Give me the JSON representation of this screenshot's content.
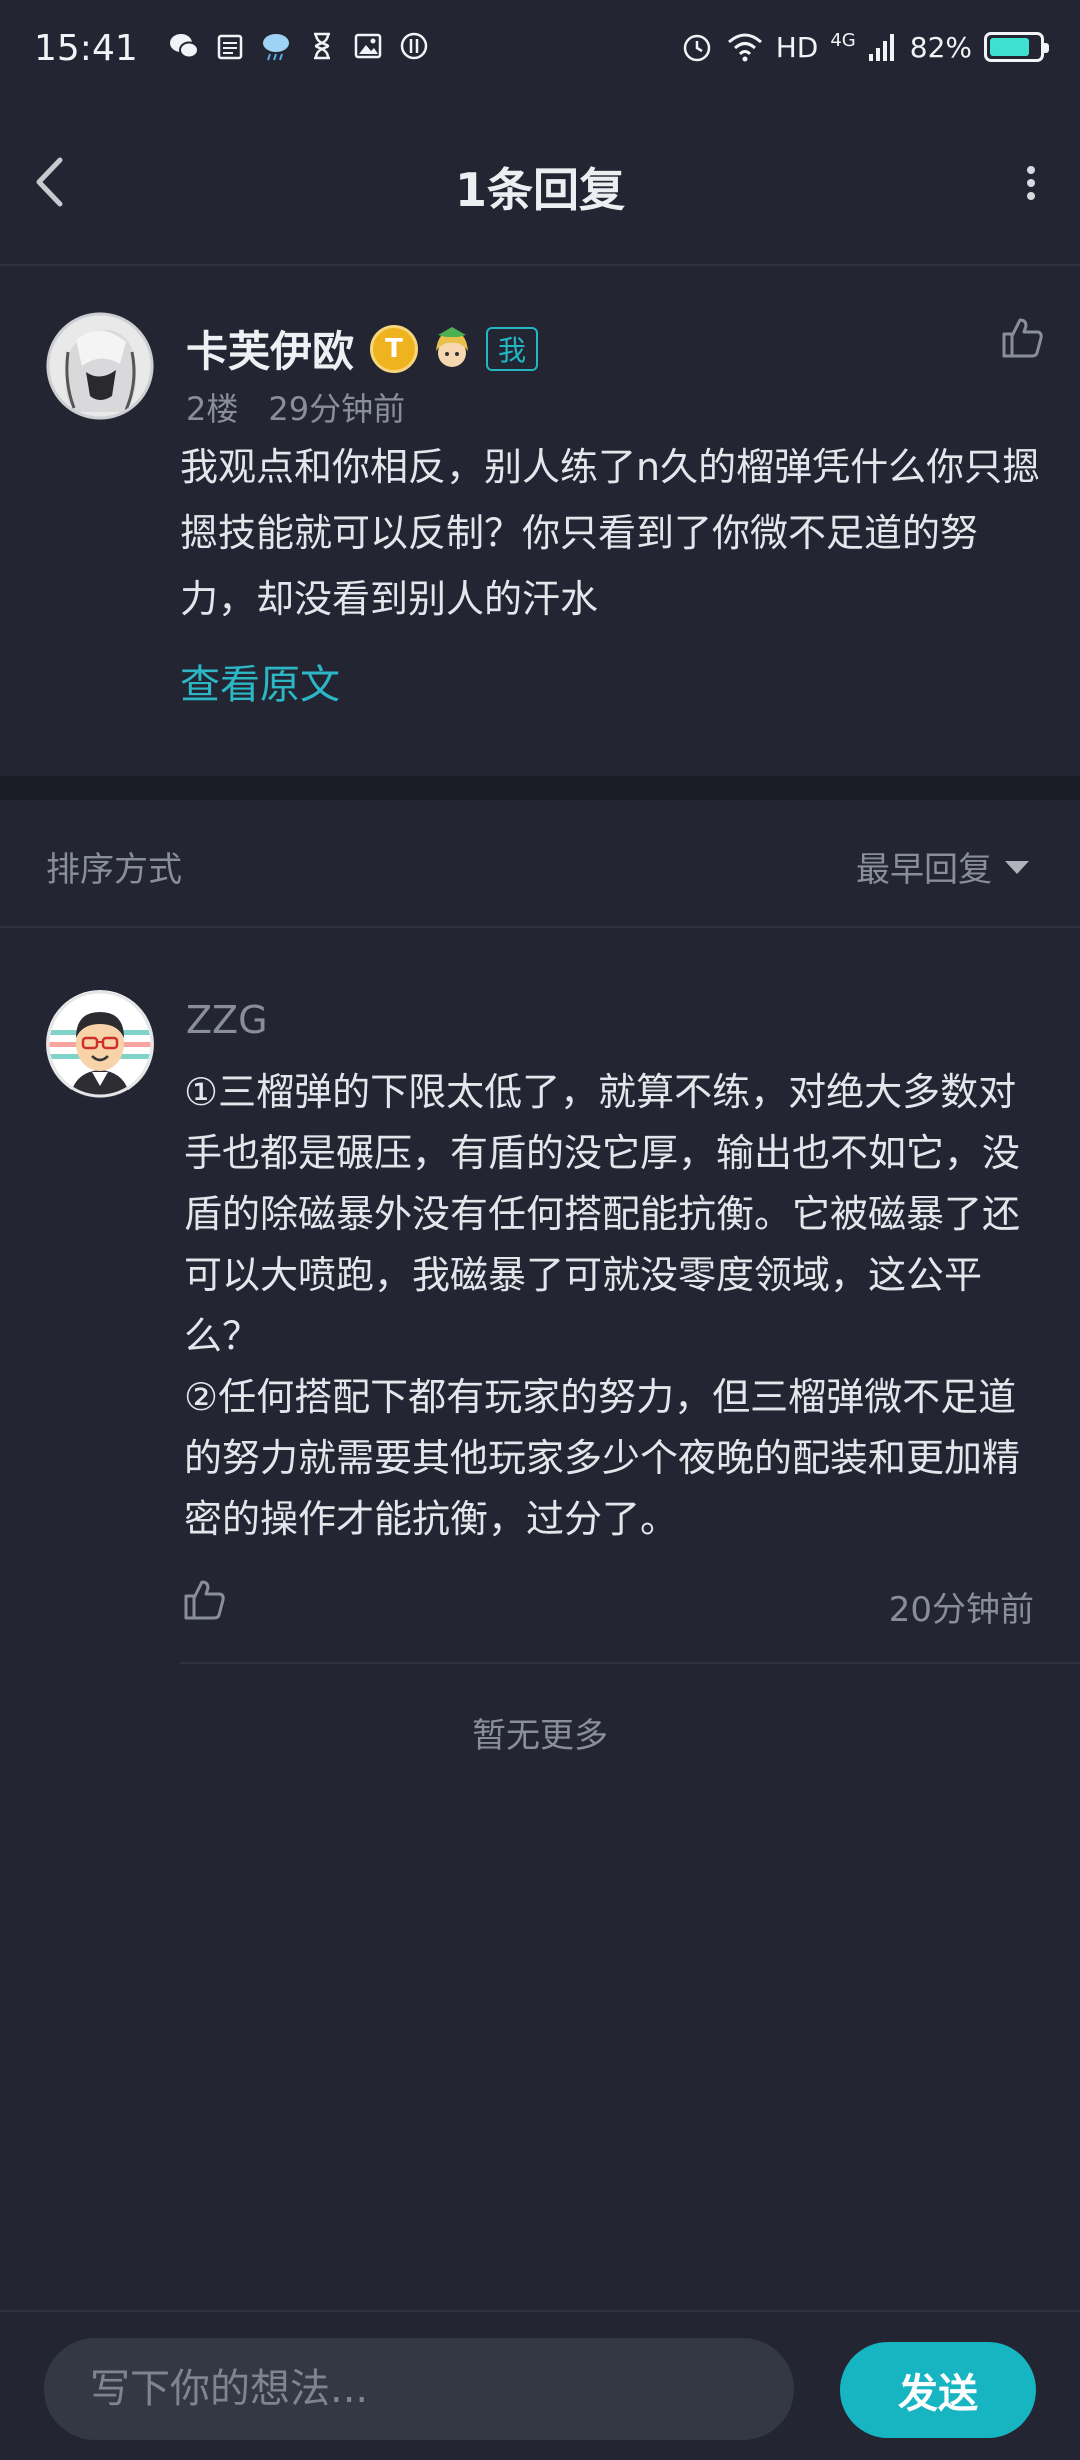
{
  "status_bar": {
    "time": "15:41",
    "network": "HD",
    "signal": "4G",
    "battery": "82%",
    "battery_level": 0.82,
    "notification_icons": [
      "wechat-icon",
      "calendar-icon",
      "weather-icon",
      "hourglass-icon",
      "gallery-icon",
      "app-icon"
    ]
  },
  "header": {
    "title": "1条回复"
  },
  "original_comment": {
    "author": "卡芙伊欧",
    "level_badge": "T",
    "me_tag": "我",
    "floor": "2楼",
    "time": "29分钟前",
    "body": "我观点和你相反，别人练了n久的榴弹凭什么你只摁摁技能就可以反制？你只看到了你微不足道的努力，却没看到别人的汗水",
    "view_original": "查看原文"
  },
  "sort": {
    "label": "排序方式",
    "selected": "最早回复"
  },
  "reply": {
    "author": "ZZG",
    "body_line1": "①三榴弹的下限太低了，就算不练，对绝大多数对手也都是碾压，有盾的没它厚，输出也不如它，没盾的除磁暴外没有任何搭配能抗衡。它被磁暴了还可以大喷跑，我磁暴了可就没零度领域，这公平么？",
    "body_line2": "②任何搭配下都有玩家的努力，但三榴弹微不足道的努力就需要其他玩家多少个夜晚的配装和更加精密的操作才能抗衡，过分了。",
    "time": "20分钟前"
  },
  "footer_text": "暂无更多",
  "composer": {
    "placeholder": "写下你的想法...",
    "send_label": "发送"
  },
  "colors": {
    "background": "#232632",
    "accent": "#17b5c2",
    "muted_text": "#8a8e99"
  }
}
